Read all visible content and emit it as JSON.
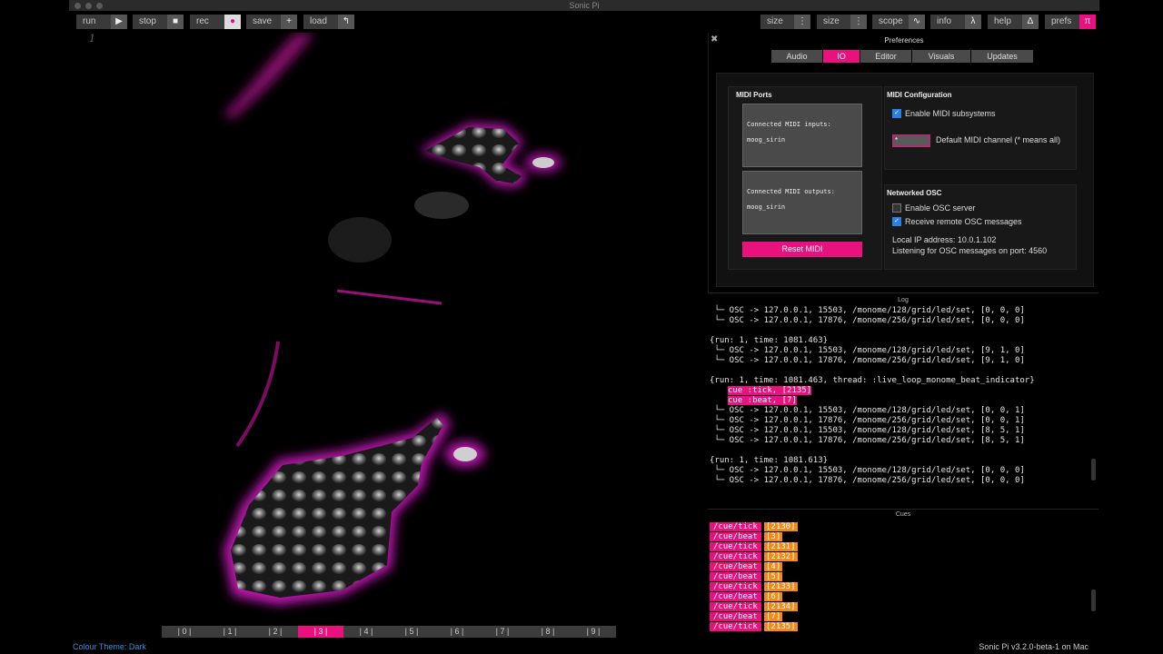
{
  "window": {
    "title": "Sonic Pi"
  },
  "toolbar": {
    "left": [
      {
        "label": "run",
        "icon": "▶"
      },
      {
        "label": "stop",
        "icon": "■"
      },
      {
        "label": "rec",
        "icon": "●"
      },
      {
        "label": "save",
        "icon": "+"
      },
      {
        "label": "load",
        "icon": "↰"
      }
    ],
    "right": [
      {
        "label": "size",
        "icon": "⋮"
      },
      {
        "label": "size",
        "icon": "⋮"
      },
      {
        "label": "scope",
        "icon": "∿"
      },
      {
        "label": "info",
        "icon": "λ"
      },
      {
        "label": "help",
        "icon": "Δ"
      },
      {
        "label": "prefs",
        "icon": "π"
      }
    ]
  },
  "editor": {
    "line_number": "1"
  },
  "buffers": {
    "tabs": [
      "| 0 |",
      "| 1 |",
      "| 2 |",
      "| 3 |",
      "| 4 |",
      "| 5 |",
      "| 6 |",
      "| 7 |",
      "| 8 |",
      "| 9 |"
    ],
    "active": "| 3 |"
  },
  "status": {
    "theme": "Colour Theme: Dark",
    "version": "Sonic Pi v3.2.0-beta-1 on Mac"
  },
  "prefs": {
    "close": "✖",
    "title": "Preferences",
    "tabs": [
      "Audio",
      "IO",
      "Editor",
      "Visuals",
      "Updates"
    ],
    "active_tab": "IO",
    "midi_ports": {
      "title": "MIDI Ports",
      "inputs_label": "Connected MIDI inputs:",
      "inputs_value": "moog_sirin",
      "outputs_label": "Connected MIDI outputs:",
      "outputs_value": "moog_sirin",
      "reset_label": "Reset MIDI"
    },
    "midi_config": {
      "title": "MIDI Configuration",
      "enable_label": "Enable MIDI subsystems",
      "channel_value": "*",
      "channel_label": "Default MIDI channel (* means all)"
    },
    "osc": {
      "title": "Networked OSC",
      "server_label": "Enable OSC server",
      "remote_label": "Receive remote OSC messages",
      "ip_text": "Local IP address: 10.0.1.102",
      "port_text": "Listening for OSC messages on port: 4560"
    }
  },
  "log": {
    "title": "Log",
    "lines": [
      " └─ OSC -> 127.0.0.1, 15503, /monome/128/grid/led/set, [0, 0, 0]",
      " └─ OSC -> 127.0.0.1, 17876, /monome/256/grid/led/set, [0, 0, 0]",
      "",
      "{run: 1, time: 1081.463}",
      " └─ OSC -> 127.0.0.1, 15503, /monome/128/grid/led/set, [9, 1, 0]",
      " └─ OSC -> 127.0.0.1, 17876, /monome/256/grid/led/set, [9, 1, 0]",
      "",
      "{run: 1, time: 1081.463, thread: :live_loop_monome_beat_indicator}",
      "CUE:cue :tick, [2135]",
      "CUE:cue :beat, [7]",
      " └─ OSC -> 127.0.0.1, 15503, /monome/128/grid/led/set, [0, 0, 1]",
      " └─ OSC -> 127.0.0.1, 17876, /monome/256/grid/led/set, [0, 0, 1]",
      " └─ OSC -> 127.0.0.1, 15503, /monome/128/grid/led/set, [8, 5, 1]",
      " └─ OSC -> 127.0.0.1, 17876, /monome/256/grid/led/set, [8, 5, 1]",
      "",
      "{run: 1, time: 1081.613}",
      " └─ OSC -> 127.0.0.1, 15503, /monome/128/grid/led/set, [0, 0, 0]",
      " └─ OSC -> 127.0.0.1, 17876, /monome/256/grid/led/set, [0, 0, 0]"
    ]
  },
  "cues": {
    "title": "Cues",
    "items": [
      {
        "path": "/cue/tick",
        "value": "[2130]"
      },
      {
        "path": "/cue/beat",
        "value": "[3]"
      },
      {
        "path": "/cue/tick",
        "value": "[2131]"
      },
      {
        "path": "/cue/tick",
        "value": "[2132]"
      },
      {
        "path": "/cue/beat",
        "value": "[4]"
      },
      {
        "path": "/cue/beat",
        "value": "[5]"
      },
      {
        "path": "/cue/tick",
        "value": "[2133]"
      },
      {
        "path": "/cue/beat",
        "value": "[6]"
      },
      {
        "path": "/cue/tick",
        "value": "[2134]"
      },
      {
        "path": "/cue/beat",
        "value": "[7]"
      },
      {
        "path": "/cue/tick",
        "value": "[2135]"
      }
    ]
  },
  "colors": {
    "accent": "#e8117d",
    "cue_value": "#f08a1a",
    "theme_link": "#2f8fd8"
  }
}
